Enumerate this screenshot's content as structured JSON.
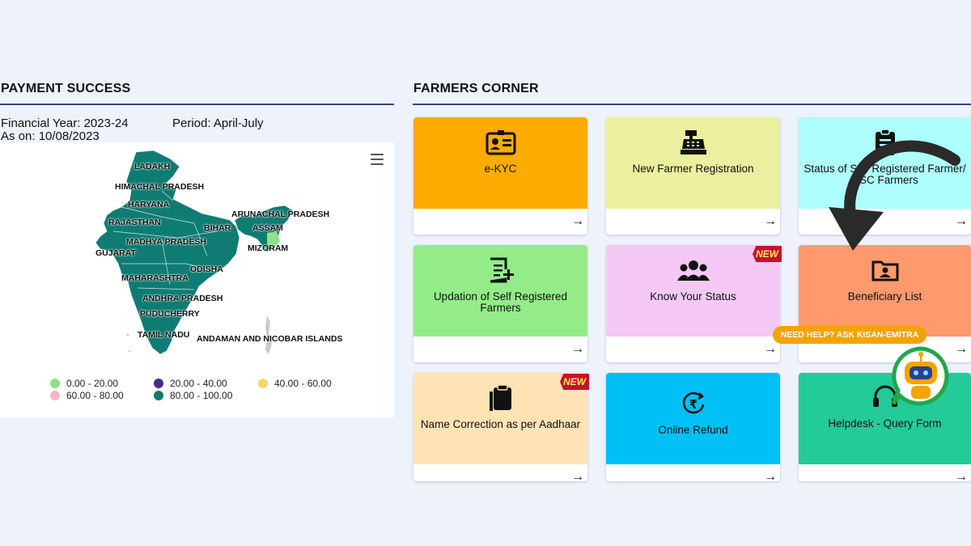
{
  "payment_success": {
    "title": "PAYMENT SUCCESS",
    "financial_year": "Financial Year: 2023-24",
    "period": "Period: April-July",
    "as_on": "As on: 10/08/2023",
    "map_labels": {
      "ladakh": "LADAKH",
      "himachal": "HIMACHAL PRADESH",
      "haryana": "HARYANA",
      "rajasthan": "RAJASTHAN",
      "madhya": "MADHYA PRADESH",
      "gujarat": "GUJARAT",
      "maharashtra": "MAHARASHTRA",
      "bihar": "BIHAR",
      "odisha": "ODISHA",
      "andhra": "ANDHRA PRADESH",
      "puducherry": "PUDUCHERRY",
      "tamil": "TAMIL NADU",
      "arunachal": "ARUNACHAL PRADESH",
      "assam": "ASSAM",
      "mizoram": "MIZORAM",
      "andaman": "ANDAMAN AND NICOBAR ISLANDS"
    },
    "legend": [
      {
        "label": "0.00 - 20.00",
        "color": "#8fe08a"
      },
      {
        "label": "20.00 - 40.00",
        "color": "#4b2a87"
      },
      {
        "label": "40.00 - 60.00",
        "color": "#f5d66a"
      },
      {
        "label": "60.00 - 80.00",
        "color": "#f3b9be"
      },
      {
        "label": "80.00 - 100.00",
        "color": "#0f7c73"
      }
    ]
  },
  "farmers_corner": {
    "title": "FARMERS CORNER",
    "cards": [
      {
        "label": "e-KYC",
        "color": "#fdab00",
        "icon": "id-card-icon"
      },
      {
        "label": "New Farmer Registration",
        "color": "#ecef9e",
        "icon": "cash-register-icon"
      },
      {
        "label": "Status of Self Registered Farmer/ CSC Farmers",
        "color": "#aefefd",
        "icon": "clipboard-list-icon"
      },
      {
        "label": "Updation of Self Registered Farmers",
        "color": "#93ec88",
        "icon": "edit-document-icon"
      },
      {
        "label": "Know Your Status",
        "color": "#f6c8f6",
        "icon": "users-icon"
      },
      {
        "label": "Beneficiary List",
        "color": "#fe9a6e",
        "icon": "folder-user-icon"
      },
      {
        "label": "Name Correction as per Aadhaar",
        "color": "#ffe3b4",
        "icon": "clipboard-icon"
      },
      {
        "label": "Online Refund",
        "color": "#00c0f6",
        "icon": "rupee-refund-icon"
      },
      {
        "label": "Helpdesk - Query Form",
        "color": "#22cb97",
        "icon": "headset-icon"
      }
    ],
    "new_badge": "NEW",
    "arrow": "→"
  },
  "help": {
    "pill": "NEED HELP? ASK KISAN-EMITRA"
  }
}
